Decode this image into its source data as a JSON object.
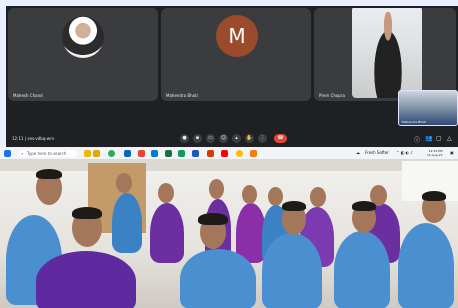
{
  "meeting": {
    "participants": [
      {
        "name": "Mahesh Chand",
        "kind": "photo"
      },
      {
        "name": "Mahendra Bhati",
        "kind": "initial",
        "initial": "M"
      },
      {
        "name": "Prem Chopra",
        "kind": "video"
      }
    ],
    "pip_name": "Mahendra Bhati",
    "time_code": "12:11  |  ses-vdbq-wrn",
    "controls": [
      "mic-icon",
      "camera-icon",
      "captions-icon",
      "emoji-icon",
      "present-icon",
      "raise-hand-icon",
      "more-icon",
      "end-call-icon"
    ],
    "side_controls": [
      "info-icon",
      "people-icon",
      "chat-icon",
      "activities-icon"
    ],
    "colors": {
      "background": "#1f2023",
      "tile": "#3b3c3f",
      "avatar": "#9c4a2c",
      "end_call": "#ea4335"
    }
  },
  "taskbar": {
    "search_placeholder": "Type here to search",
    "weather": "Fresh Softer",
    "clock_time": "12:34 PM",
    "clock_date": "11-Aug-23"
  }
}
